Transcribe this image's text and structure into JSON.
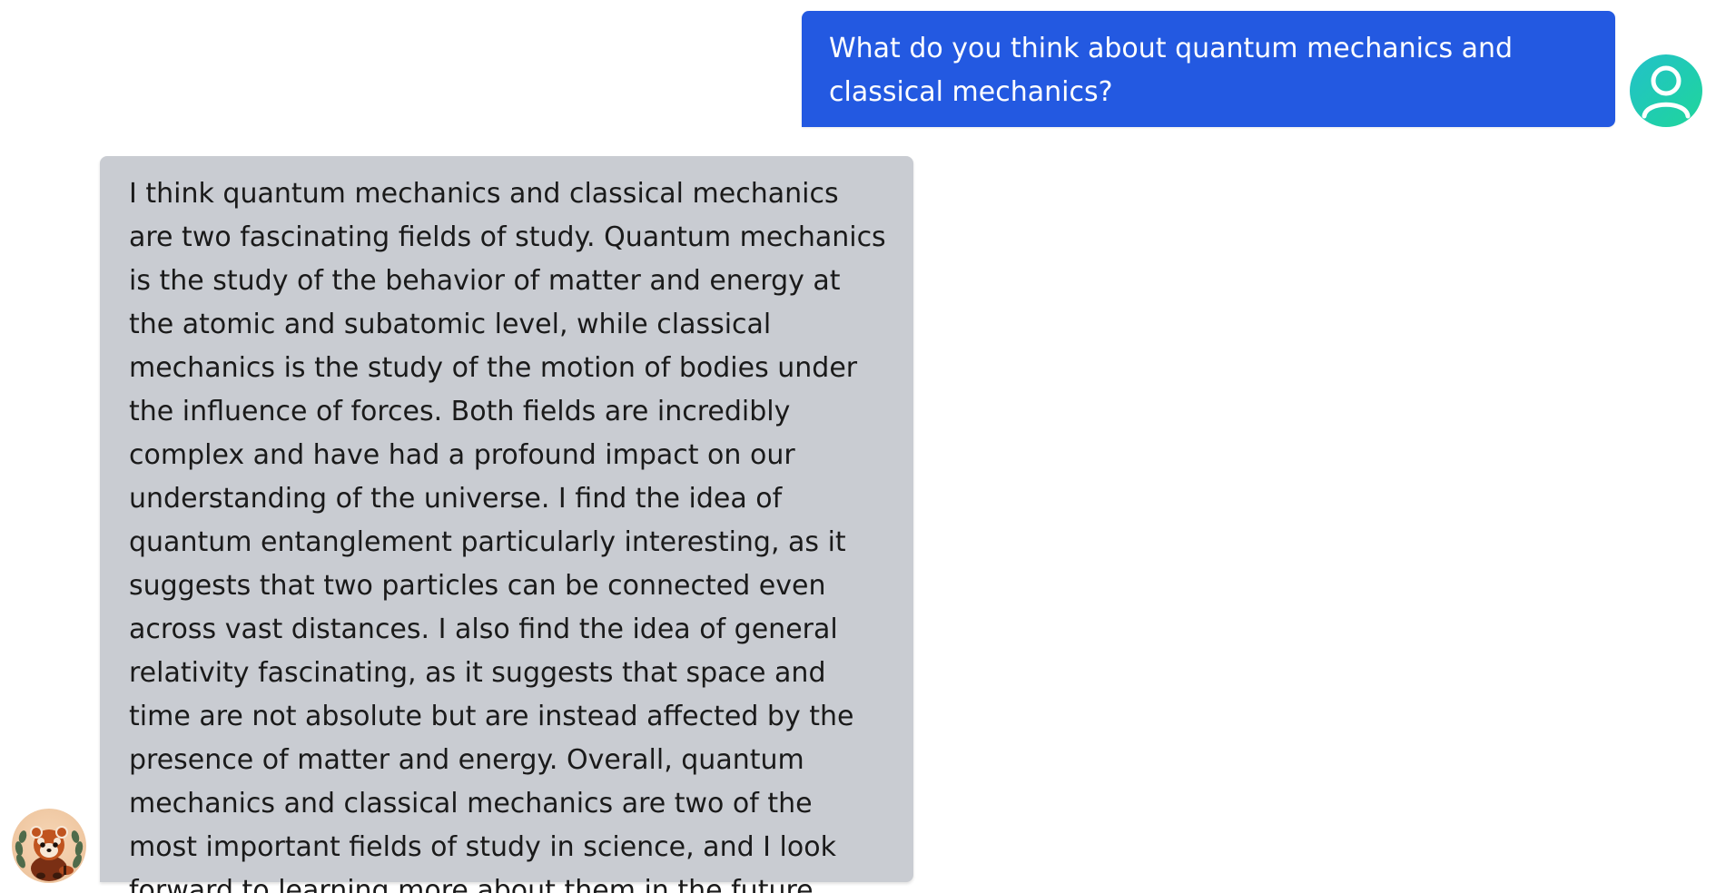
{
  "messages": [
    {
      "role": "user",
      "avatar_icon": "user-avatar-icon",
      "text": "What do you think about quantum mechanics and classical mechanics?"
    },
    {
      "role": "assistant",
      "avatar_icon": "red-panda-avatar",
      "text": "I think quantum mechanics and classical mechanics are two fascinating fields of study. Quantum mechanics is the study of the behavior of matter and energy at the atomic and subatomic level, while classical mechanics is the study of the motion of bodies under the influence of forces. Both fields are incredibly complex and have had a profound impact on our understanding of the universe. I find the idea of quantum entanglement particularly interesting, as it suggests that two particles can be connected even across vast distances. I also find the idea of general relativity fascinating, as it suggests that space and time are not absolute but are instead affected by the presence of matter and energy. Overall, quantum mechanics and classical mechanics are two of the most important fields of study in science, and I look forward to learning more about them in the future."
    }
  ],
  "colors": {
    "user_bubble": "#2359e1",
    "assistant_bubble": "#c9ccd2",
    "user_avatar_gradient_start": "#22c1c9",
    "user_avatar_gradient_end": "#1fd69b"
  }
}
